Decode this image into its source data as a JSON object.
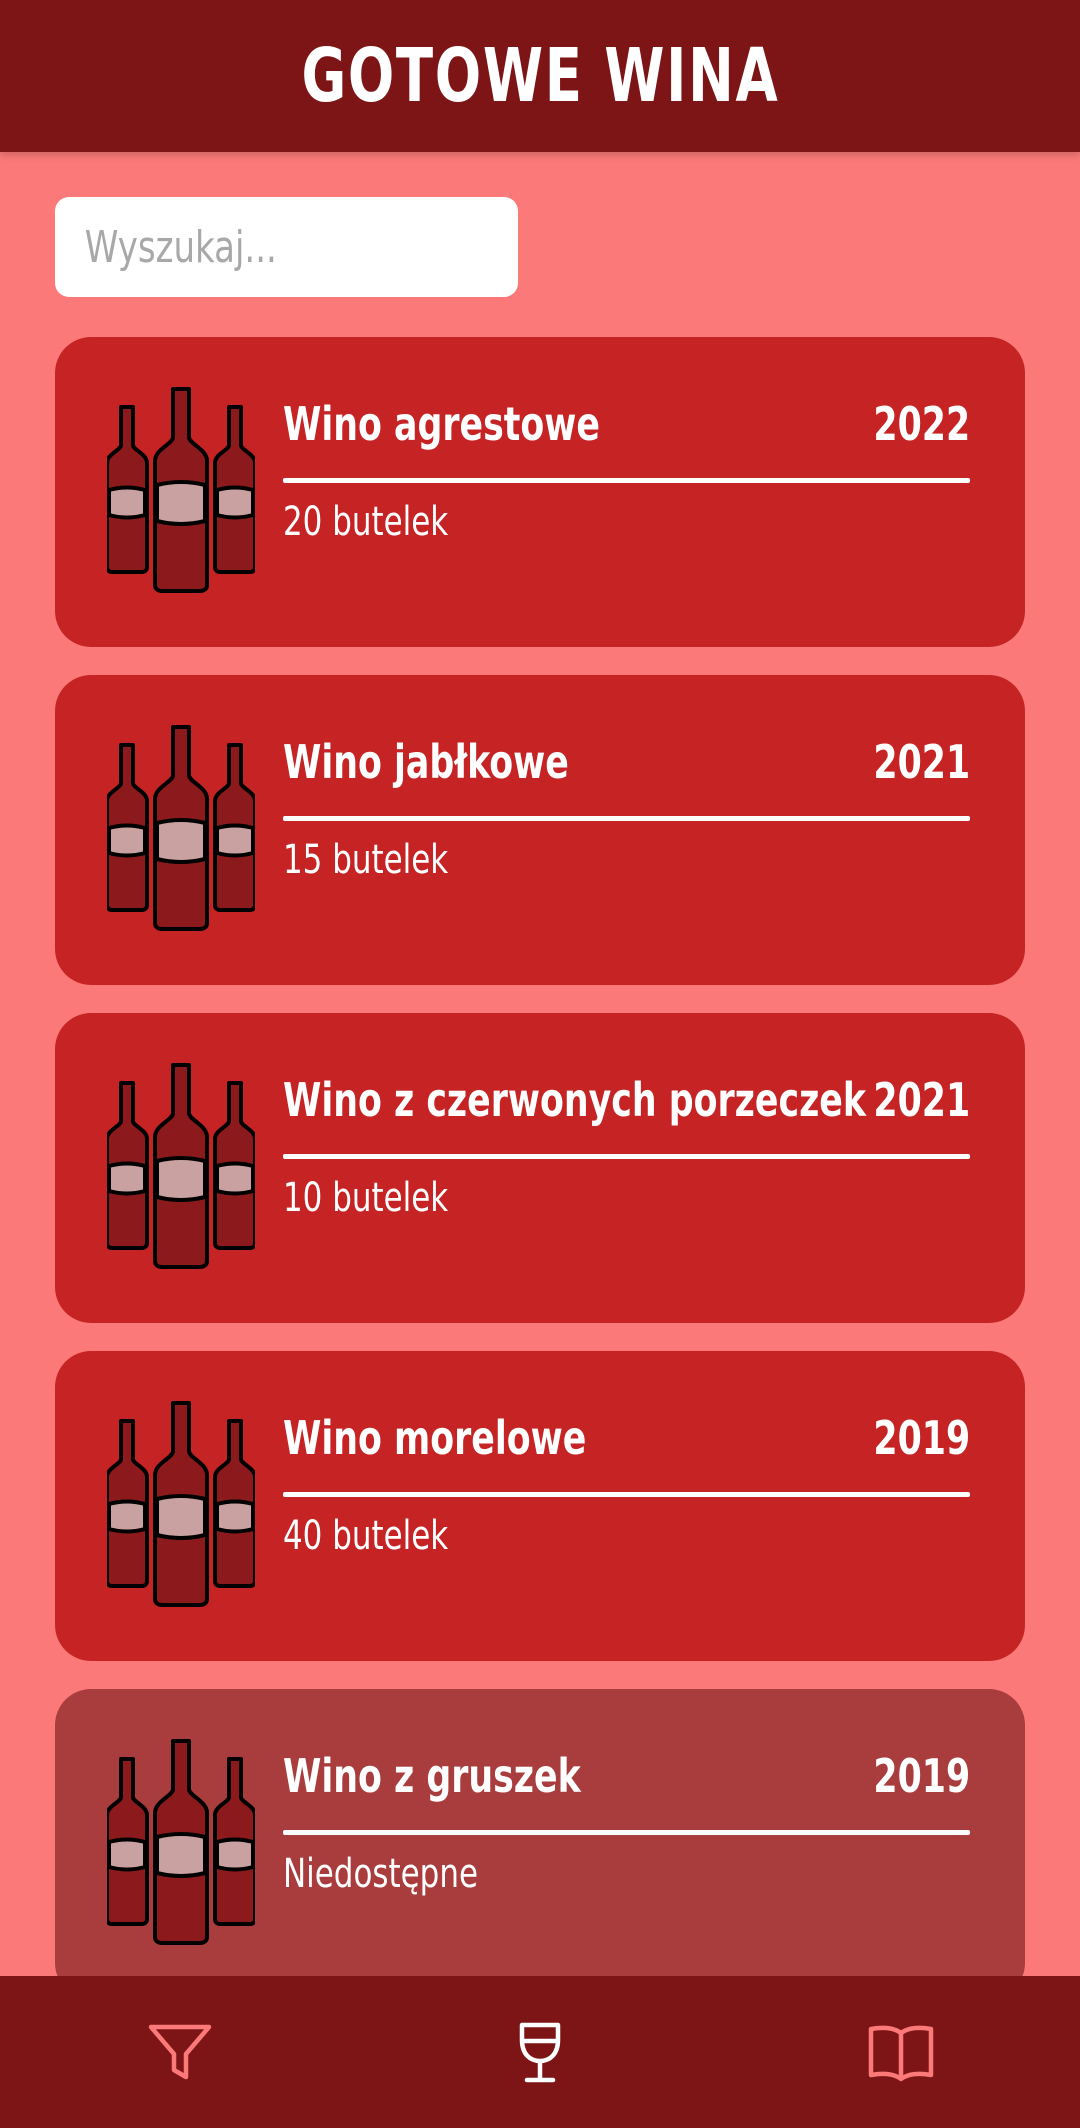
{
  "header": {
    "title": "GOTOWE WINA"
  },
  "search": {
    "placeholder": "Wyszukaj..."
  },
  "wines": [
    {
      "name": "Wino agrestowe",
      "year": "2022",
      "count": "20 butelek",
      "available": true
    },
    {
      "name": "Wino jabłkowe",
      "year": "2021",
      "count": "15 butelek",
      "available": true
    },
    {
      "name": "Wino z czerwonych porzeczek",
      "year": "2021",
      "count": "10 butelek",
      "available": true
    },
    {
      "name": "Wino morelowe",
      "year": "2019",
      "count": "40 butelek",
      "available": true
    },
    {
      "name": "Wino z gruszek",
      "year": "2019",
      "count": "Niedostępne",
      "available": false
    }
  ],
  "nav": {
    "items": [
      {
        "icon": "filter-icon",
        "active": false
      },
      {
        "icon": "wine-glass-icon",
        "active": true
      },
      {
        "icon": "book-icon",
        "active": false
      }
    ]
  },
  "colors": {
    "background": "#fb7a79",
    "header": "#7d1416",
    "card": "#c62324",
    "card_unavailable": "#a93d3e",
    "bottle": "#8c1a1d",
    "label": "#c9a1a1",
    "nav_icon": "#fb7a79",
    "nav_icon_active": "#ffffff"
  }
}
